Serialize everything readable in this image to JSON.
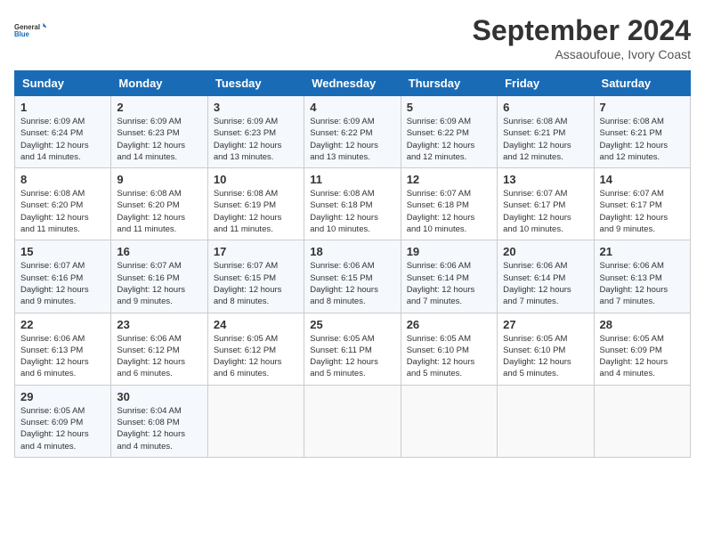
{
  "logo": {
    "text_general": "General",
    "text_blue": "Blue"
  },
  "title": "September 2024",
  "subtitle": "Assaoufoue, Ivory Coast",
  "days_of_week": [
    "Sunday",
    "Monday",
    "Tuesday",
    "Wednesday",
    "Thursday",
    "Friday",
    "Saturday"
  ],
  "weeks": [
    [
      {
        "day": "1",
        "info": "Sunrise: 6:09 AM\nSunset: 6:24 PM\nDaylight: 12 hours\nand 14 minutes."
      },
      {
        "day": "2",
        "info": "Sunrise: 6:09 AM\nSunset: 6:23 PM\nDaylight: 12 hours\nand 14 minutes."
      },
      {
        "day": "3",
        "info": "Sunrise: 6:09 AM\nSunset: 6:23 PM\nDaylight: 12 hours\nand 13 minutes."
      },
      {
        "day": "4",
        "info": "Sunrise: 6:09 AM\nSunset: 6:22 PM\nDaylight: 12 hours\nand 13 minutes."
      },
      {
        "day": "5",
        "info": "Sunrise: 6:09 AM\nSunset: 6:22 PM\nDaylight: 12 hours\nand 12 minutes."
      },
      {
        "day": "6",
        "info": "Sunrise: 6:08 AM\nSunset: 6:21 PM\nDaylight: 12 hours\nand 12 minutes."
      },
      {
        "day": "7",
        "info": "Sunrise: 6:08 AM\nSunset: 6:21 PM\nDaylight: 12 hours\nand 12 minutes."
      }
    ],
    [
      {
        "day": "8",
        "info": "Sunrise: 6:08 AM\nSunset: 6:20 PM\nDaylight: 12 hours\nand 11 minutes."
      },
      {
        "day": "9",
        "info": "Sunrise: 6:08 AM\nSunset: 6:20 PM\nDaylight: 12 hours\nand 11 minutes."
      },
      {
        "day": "10",
        "info": "Sunrise: 6:08 AM\nSunset: 6:19 PM\nDaylight: 12 hours\nand 11 minutes."
      },
      {
        "day": "11",
        "info": "Sunrise: 6:08 AM\nSunset: 6:18 PM\nDaylight: 12 hours\nand 10 minutes."
      },
      {
        "day": "12",
        "info": "Sunrise: 6:07 AM\nSunset: 6:18 PM\nDaylight: 12 hours\nand 10 minutes."
      },
      {
        "day": "13",
        "info": "Sunrise: 6:07 AM\nSunset: 6:17 PM\nDaylight: 12 hours\nand 10 minutes."
      },
      {
        "day": "14",
        "info": "Sunrise: 6:07 AM\nSunset: 6:17 PM\nDaylight: 12 hours\nand 9 minutes."
      }
    ],
    [
      {
        "day": "15",
        "info": "Sunrise: 6:07 AM\nSunset: 6:16 PM\nDaylight: 12 hours\nand 9 minutes."
      },
      {
        "day": "16",
        "info": "Sunrise: 6:07 AM\nSunset: 6:16 PM\nDaylight: 12 hours\nand 9 minutes."
      },
      {
        "day": "17",
        "info": "Sunrise: 6:07 AM\nSunset: 6:15 PM\nDaylight: 12 hours\nand 8 minutes."
      },
      {
        "day": "18",
        "info": "Sunrise: 6:06 AM\nSunset: 6:15 PM\nDaylight: 12 hours\nand 8 minutes."
      },
      {
        "day": "19",
        "info": "Sunrise: 6:06 AM\nSunset: 6:14 PM\nDaylight: 12 hours\nand 7 minutes."
      },
      {
        "day": "20",
        "info": "Sunrise: 6:06 AM\nSunset: 6:14 PM\nDaylight: 12 hours\nand 7 minutes."
      },
      {
        "day": "21",
        "info": "Sunrise: 6:06 AM\nSunset: 6:13 PM\nDaylight: 12 hours\nand 7 minutes."
      }
    ],
    [
      {
        "day": "22",
        "info": "Sunrise: 6:06 AM\nSunset: 6:13 PM\nDaylight: 12 hours\nand 6 minutes."
      },
      {
        "day": "23",
        "info": "Sunrise: 6:06 AM\nSunset: 6:12 PM\nDaylight: 12 hours\nand 6 minutes."
      },
      {
        "day": "24",
        "info": "Sunrise: 6:05 AM\nSunset: 6:12 PM\nDaylight: 12 hours\nand 6 minutes."
      },
      {
        "day": "25",
        "info": "Sunrise: 6:05 AM\nSunset: 6:11 PM\nDaylight: 12 hours\nand 5 minutes."
      },
      {
        "day": "26",
        "info": "Sunrise: 6:05 AM\nSunset: 6:10 PM\nDaylight: 12 hours\nand 5 minutes."
      },
      {
        "day": "27",
        "info": "Sunrise: 6:05 AM\nSunset: 6:10 PM\nDaylight: 12 hours\nand 5 minutes."
      },
      {
        "day": "28",
        "info": "Sunrise: 6:05 AM\nSunset: 6:09 PM\nDaylight: 12 hours\nand 4 minutes."
      }
    ],
    [
      {
        "day": "29",
        "info": "Sunrise: 6:05 AM\nSunset: 6:09 PM\nDaylight: 12 hours\nand 4 minutes."
      },
      {
        "day": "30",
        "info": "Sunrise: 6:04 AM\nSunset: 6:08 PM\nDaylight: 12 hours\nand 4 minutes."
      },
      {
        "day": "",
        "info": ""
      },
      {
        "day": "",
        "info": ""
      },
      {
        "day": "",
        "info": ""
      },
      {
        "day": "",
        "info": ""
      },
      {
        "day": "",
        "info": ""
      }
    ]
  ]
}
